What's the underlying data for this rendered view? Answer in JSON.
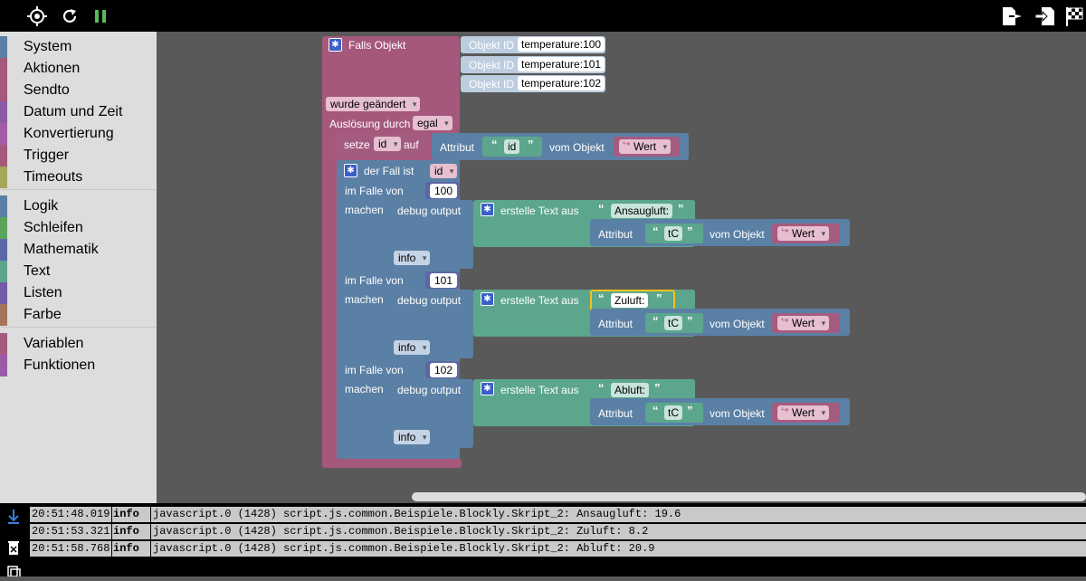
{
  "toolbar": {
    "icons": [
      "target-icon",
      "refresh-icon",
      "pause-icon",
      "export-icon",
      "import-icon",
      "checkered-flag-icon"
    ],
    "pause_color": "#5cb85c"
  },
  "sidebar": {
    "categories": [
      {
        "label": "System",
        "color": "#5b80a5"
      },
      {
        "label": "Aktionen",
        "color": "#a5587c"
      },
      {
        "label": "Sendto",
        "color": "#a5587c"
      },
      {
        "label": "Datum und Zeit",
        "color": "#8b5ca5"
      },
      {
        "label": "Konvertierung",
        "color": "#a55ba5"
      },
      {
        "label": "Trigger",
        "color": "#a5587c"
      },
      {
        "label": "Timeouts",
        "color": "#a5a55b"
      },
      {
        "label": "Logik",
        "color": "#5b80a5"
      },
      {
        "label": "Schleifen",
        "color": "#5ba55b"
      },
      {
        "label": "Mathematik",
        "color": "#5b67a5"
      },
      {
        "label": "Text",
        "color": "#5ba58c"
      },
      {
        "label": "Listen",
        "color": "#745ba5"
      },
      {
        "label": "Farbe",
        "color": "#a5745b"
      },
      {
        "label": "Variablen",
        "color": "#a55b80"
      },
      {
        "label": "Funktionen",
        "color": "#995ba5"
      }
    ]
  },
  "blocks": {
    "trigger": {
      "title": "Falls Objekt",
      "objekt_id_label": "Objekt ID",
      "ids": [
        "temperature:100",
        "temperature:101",
        "temperature:102"
      ],
      "wurde": "wurde geändert",
      "ausloesung_label": "Auslösung durch",
      "ausloesung_value": "egal"
    },
    "setze": {
      "label": "setze",
      "var": "id",
      "auf": "auf",
      "attribut": "Attribut",
      "id_text": "id",
      "vom_objekt": "vom Objekt",
      "wert": "Wert"
    },
    "switch": {
      "title": "der Fall ist",
      "var": "id",
      "im_falle_von": "im Falle von",
      "machen": "machen",
      "cases": [
        {
          "value": "100",
          "debug": "debug output",
          "erstelle": "erstelle Text aus",
          "text": "Ansaugluft:",
          "attribut": "Attribut",
          "tc": "tC",
          "vom_objekt": "vom Objekt",
          "wert": "Wert",
          "level": "info"
        },
        {
          "value": "101",
          "debug": "debug output",
          "erstelle": "erstelle Text aus",
          "text": "Zuluft:",
          "attribut": "Attribut",
          "tc": "tC",
          "vom_objekt": "vom Objekt",
          "wert": "Wert",
          "level": "info"
        },
        {
          "value": "102",
          "debug": "debug output",
          "erstelle": "erstelle Text aus",
          "text": "Abluft:",
          "attribut": "Attribut",
          "tc": "tC",
          "vom_objekt": "vom Objekt",
          "wert": "Wert",
          "level": "info"
        }
      ]
    }
  },
  "log": {
    "icons": [
      "scroll-down-icon",
      "clear-log-icon",
      "copy-icon"
    ],
    "rows": [
      {
        "time": "20:51:48.019",
        "level": "info",
        "message": "javascript.0 (1428) script.js.common.Beispiele.Blockly.Skript_2: Ansaugluft: 19.6"
      },
      {
        "time": "20:51:53.321",
        "level": "info",
        "message": "javascript.0 (1428) script.js.common.Beispiele.Blockly.Skript_2: Zuluft: 8.2"
      },
      {
        "time": "20:51:58.768",
        "level": "info",
        "message": "javascript.0 (1428) script.js.common.Beispiele.Blockly.Skript_2: Abluft: 20.9"
      }
    ]
  }
}
